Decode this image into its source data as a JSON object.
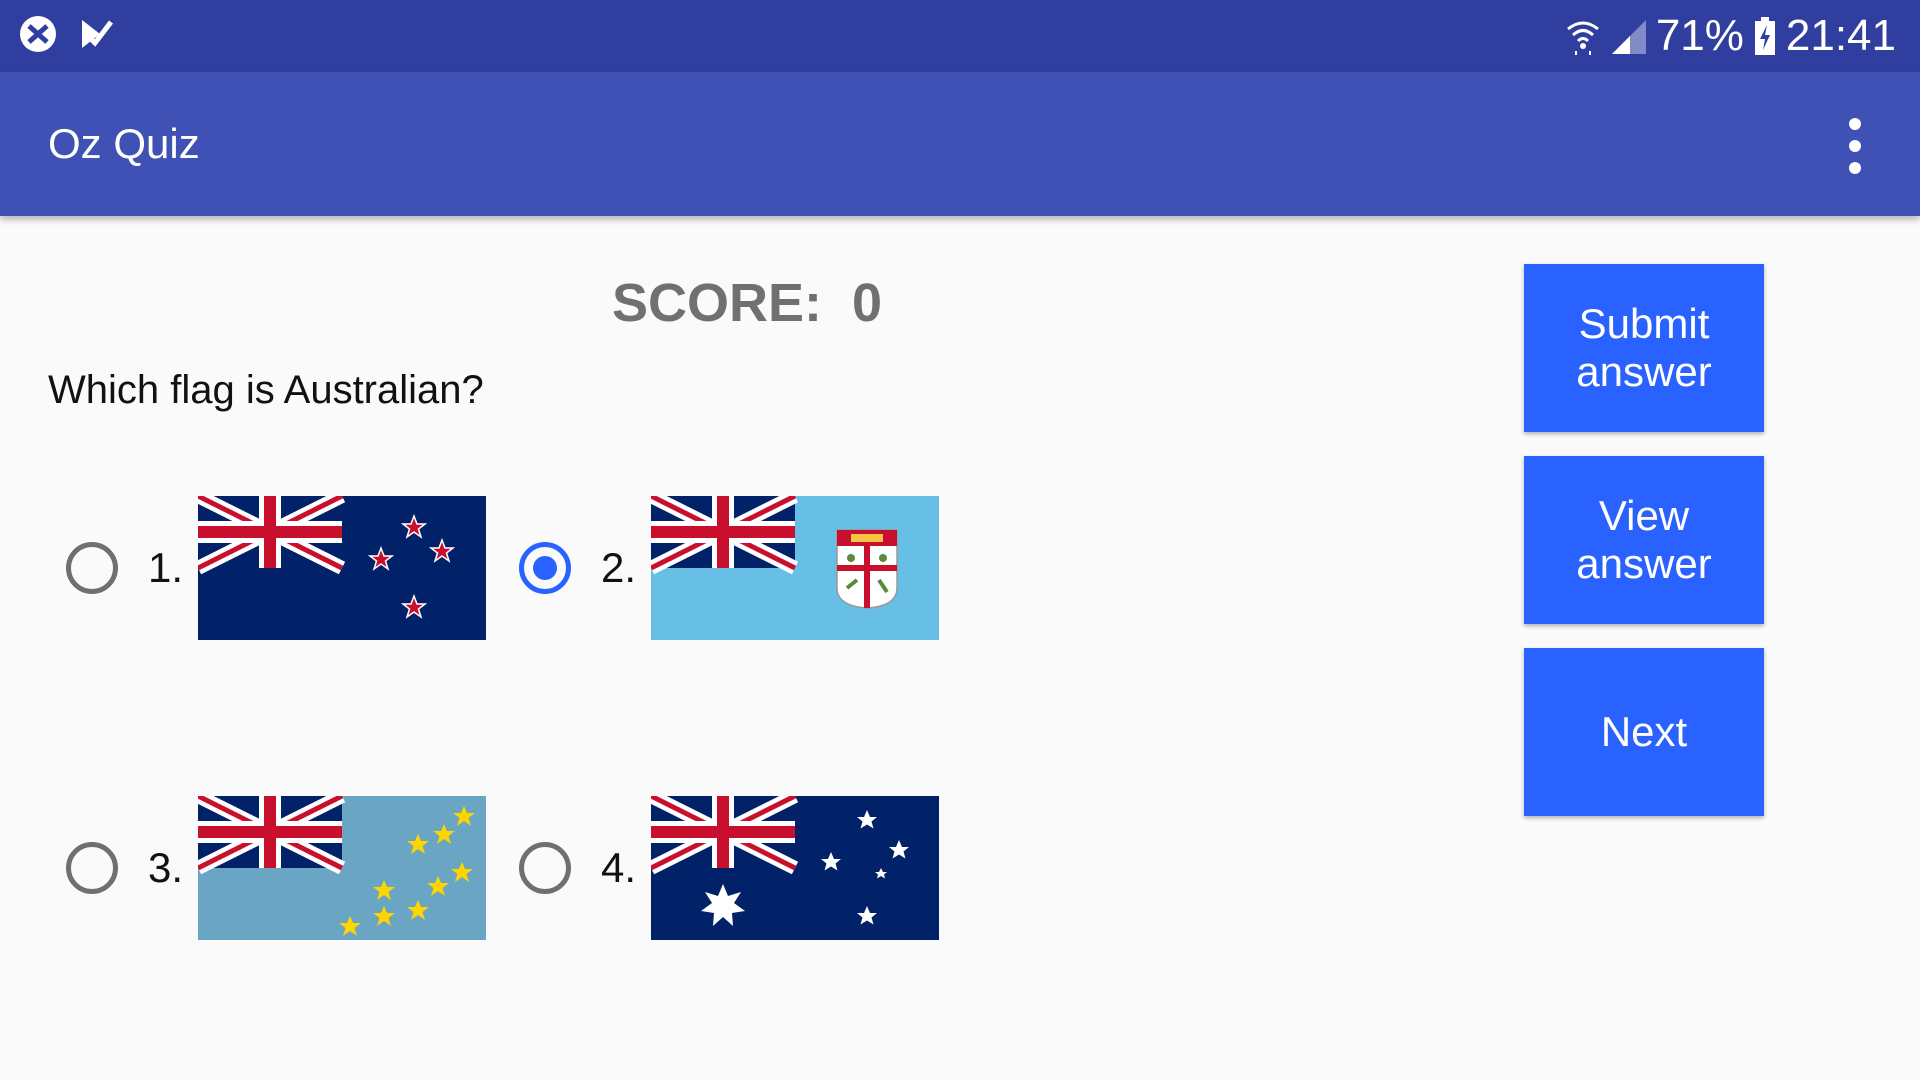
{
  "status_bar": {
    "battery": "71%",
    "time": "21:41",
    "left_icons": [
      "app-notification-icon",
      "task-check-icon"
    ],
    "right_icons": [
      "wifi-icon",
      "signal-icon",
      "battery-charging-icon"
    ]
  },
  "app_bar": {
    "title": "Oz Quiz",
    "menu_icon": "overflow-menu-icon"
  },
  "quiz": {
    "score_text": "SCORE:  0",
    "question": "Which flag is Australian?",
    "options": [
      {
        "label": "1.",
        "flag": "new-zealand-flag",
        "selected": false
      },
      {
        "label": "2.",
        "flag": "fiji-flag",
        "selected": true
      },
      {
        "label": "3.",
        "flag": "tuvalu-flag",
        "selected": false
      },
      {
        "label": "4.",
        "flag": "australia-flag",
        "selected": false
      }
    ]
  },
  "buttons": {
    "submit": "Submit answer",
    "view": "View answer",
    "next": "Next"
  },
  "colors": {
    "status_bar": "#303f9f",
    "app_bar": "#3f51b5",
    "button": "#2962ff",
    "radio_selected": "#2962ff",
    "background": "#fafafa"
  }
}
